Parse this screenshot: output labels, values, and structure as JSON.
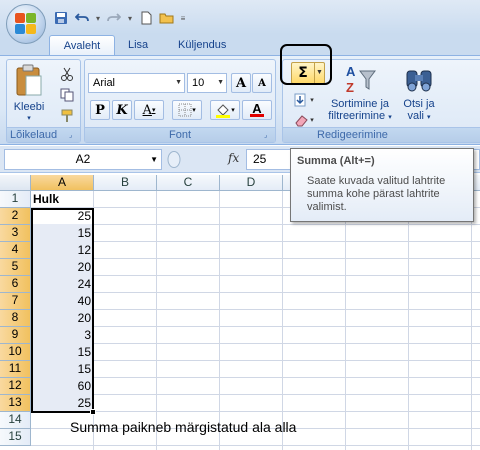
{
  "quick_access": {
    "save_icon": "save-icon",
    "undo_icon": "undo-icon",
    "redo_icon": "redo-icon",
    "new_icon": "new-document-icon",
    "open_icon": "open-folder-icon",
    "customize_glyph": "≡"
  },
  "tabs": [
    {
      "label": "Avaleht",
      "active": true
    },
    {
      "label": "Lisa",
      "active": false
    },
    {
      "label": "Küljendus",
      "active": false
    }
  ],
  "ribbon": {
    "clipboard": {
      "label": "Lõikelaud",
      "paste_label": "Kleebi"
    },
    "font": {
      "label": "Font",
      "font_name": "Arial",
      "font_size": "10",
      "grow_label": "A",
      "shrink_label": "A",
      "bold_label": "P",
      "italic_label": "K",
      "underline_label": "A",
      "font_color_label": "A"
    },
    "editing": {
      "label": "Redigeerimine",
      "sum_label": "Σ",
      "sort_label_line1": "Sortimine ja",
      "sort_label_line2": "filtreerimine",
      "find_label_line1": "Otsi ja",
      "find_label_line2": "vali"
    }
  },
  "formula_bar": {
    "name_box": "A2",
    "fx_label": "fx",
    "value": "25"
  },
  "tooltip": {
    "title": "Summa (Alt+=)",
    "body": "Saate kuvada valitud lahtrite summa kohe pärast lahtrite valimist."
  },
  "sheet": {
    "columns": [
      "A",
      "B",
      "C",
      "D"
    ],
    "rows": [
      "1",
      "2",
      "3",
      "4",
      "5",
      "6",
      "7",
      "8",
      "9",
      "10",
      "11",
      "12",
      "13",
      "14",
      "15"
    ],
    "header_cell": "Hulk",
    "values": [
      "25",
      "15",
      "12",
      "20",
      "24",
      "40",
      "20",
      "3",
      "15",
      "15",
      "60",
      "25"
    ],
    "note": "Summa paikneb märgistatud ala alla"
  },
  "colors": {
    "selection_fill": "#e6ebf5",
    "selected_header": "#f1c15f",
    "ribbon_text": "#15428b"
  }
}
